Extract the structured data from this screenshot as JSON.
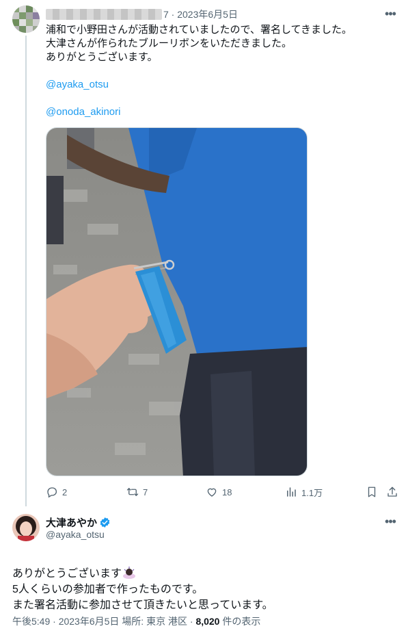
{
  "tweet1": {
    "meta_suffix": "7 · 2023年6月5日",
    "text": "浦和で小野田さんが活動されていましたので、署名してきました。\n大津さんが作られたブルーリボンをいただきました。\nありがとうございます。",
    "mentions": [
      "@ayaka_otsu",
      "@onoda_akinori"
    ],
    "photo_icon": "photo-blue-ribbon-pin",
    "stats": {
      "replies": "2",
      "retweets": "7",
      "likes": "18",
      "views": "1.1万"
    }
  },
  "tweet2": {
    "name": "大津あやか",
    "handle": "@ayaka_otsu",
    "body_line1": "ありがとうございます",
    "body_rest": "5人くらいの参加者で作ったものです。\nまた署名活動に参加させて頂きたいと思っています。",
    "footer": {
      "time": "午後5:49",
      "date": "2023年6月5日",
      "place_label": "場所: 東京 港区",
      "views": "8,020",
      "views_suffix": "件の表示"
    }
  },
  "colors": {
    "accent": "#1d9bf0",
    "muted": "#536471",
    "ribbon": "#2b8fd6"
  }
}
